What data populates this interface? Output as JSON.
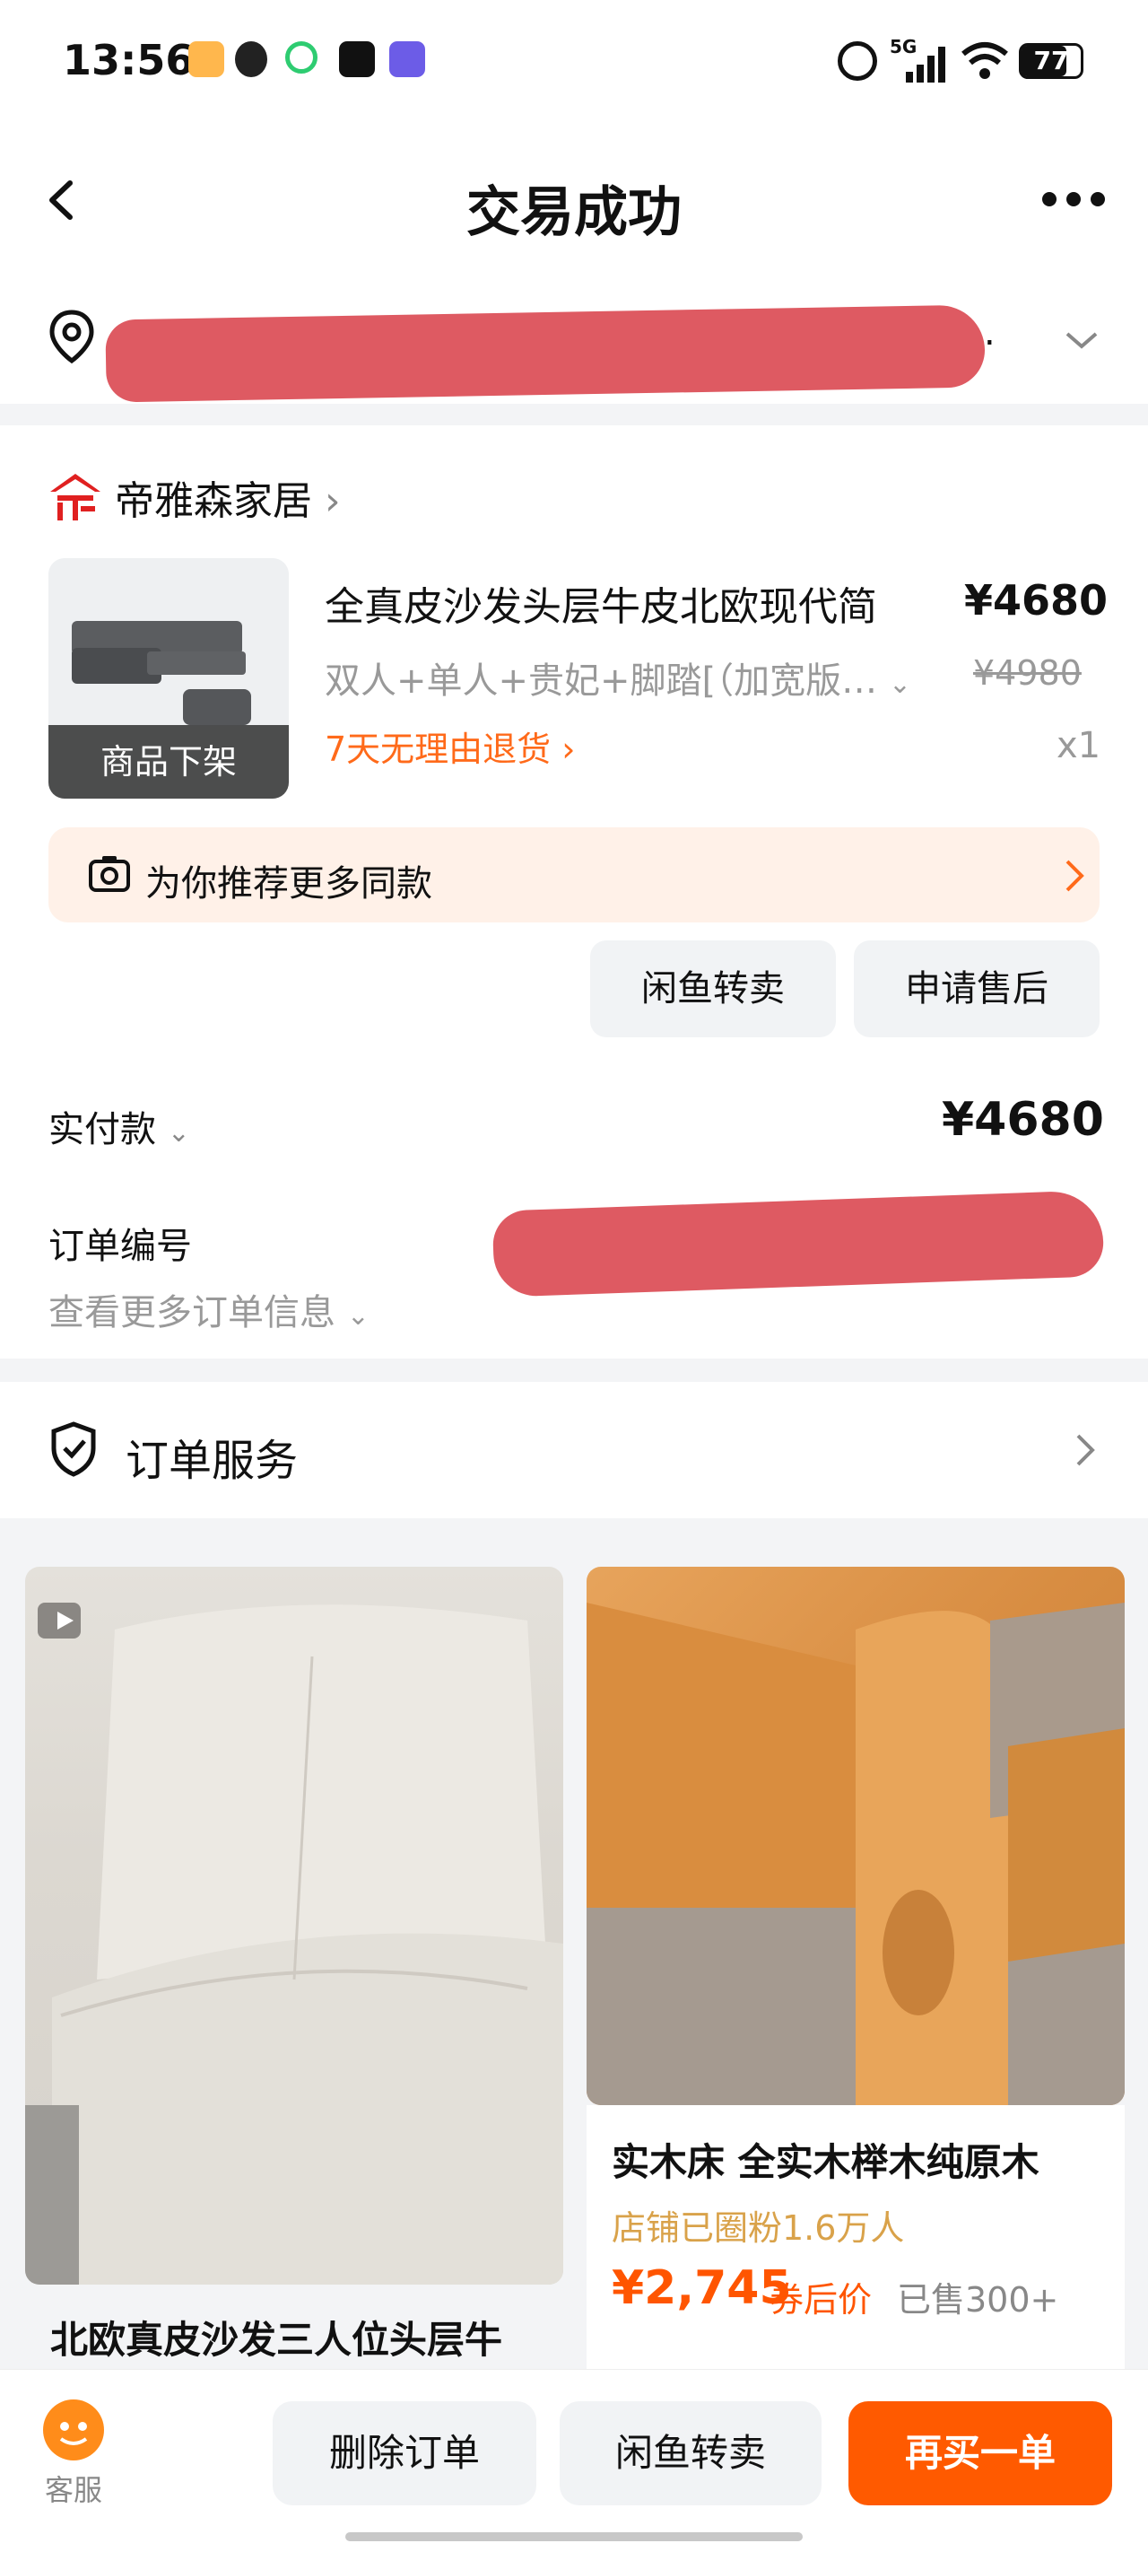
{
  "status_bar": {
    "time": "13:56",
    "network": "5G",
    "battery": "77"
  },
  "header": {
    "title": "交易成功",
    "back_icon": "chevron-left-icon",
    "more_icon": "more-dots-icon"
  },
  "address": {
    "text": "…",
    "icon": "location-pin-icon"
  },
  "order": {
    "shop_name": "帝雅森家居",
    "product_title": "全真皮沙发头层牛皮北欧现代简",
    "price": "¥4680",
    "sku": "双人+单人+贵妃+脚踏[（加宽版…",
    "original_price": "¥4980",
    "return_policy": "7天无理由退货 ›",
    "quantity": "x1",
    "delisted_label": "商品下架",
    "recommend_bar": "为你推荐更多同款",
    "btn_resell": "闲鱼转卖",
    "btn_aftersale": "申请售后",
    "paid_label": "实付款",
    "paid_value": "¥4680",
    "order_no_label": "订单编号",
    "more_info": "查看更多订单信息"
  },
  "service": {
    "label": "订单服务"
  },
  "recommendations": [
    {
      "title": "北欧真皮沙发三人位头层牛"
    },
    {
      "title": "实木床 全实木榉木纯原木",
      "fans": "店铺已圈粉1.6万人",
      "price": "¥2,745",
      "price_suffix": "券后价",
      "sold": "已售300+"
    }
  ],
  "bottom_bar": {
    "service_label": "客服",
    "delete": "删除订单",
    "resell": "闲鱼转卖",
    "rebuy": "再买一单"
  },
  "colors": {
    "accent": "#ff5500",
    "return": "#ff6a1a",
    "rebuy_button": "#ff5a00",
    "redaction": "#de5a62"
  }
}
